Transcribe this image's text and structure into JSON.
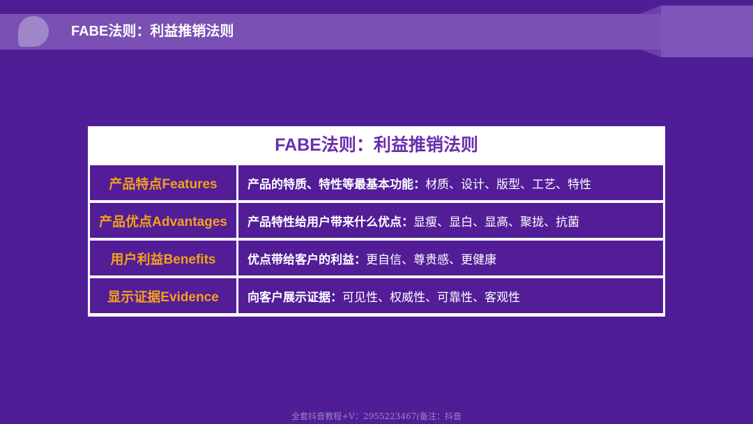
{
  "header": {
    "title": "FABE法则：利益推销法则"
  },
  "table": {
    "title": "FABE法则：利益推销法则",
    "rows": [
      {
        "label": "产品特点Features",
        "lead": "产品的特质、特性等最基本功能：",
        "detail": "材质、设计、版型、工艺、特性"
      },
      {
        "label": "产品优点Advantages",
        "lead": "产品特性给用户带来什么优点：",
        "detail": "显瘦、显白、显高、聚拢、抗菌"
      },
      {
        "label": "用户利益Benefits",
        "lead": "优点带给客户的利益：",
        "detail": "更自信、尊贵感、更健康"
      },
      {
        "label": "显示证据Evidence",
        "lead": "向客户展示证据：",
        "detail": "可见性、权威性、可靠性、客观性"
      }
    ]
  },
  "footer": {
    "text": "全套抖音教程+V：2955223467(备注：抖音"
  },
  "colors": {
    "background": "#4f1e97",
    "banner": "#7a50b4",
    "label_accent": "#f5a01a",
    "title_purple": "#6a2eab"
  }
}
